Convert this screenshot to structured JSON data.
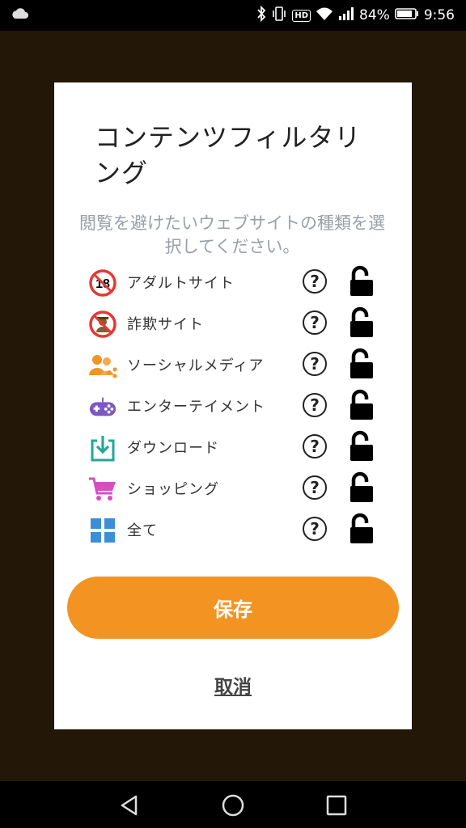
{
  "status_bar": {
    "battery_percent": "84%",
    "time": "9:56",
    "hd_badge": "HD",
    "icons": [
      "cloud-icon",
      "bluetooth-icon",
      "vibrate-icon",
      "hd-icon",
      "wifi-icon",
      "signal-icon",
      "battery-icon"
    ]
  },
  "dialog": {
    "title": "コンテンツフィルタリング",
    "subtitle": "閲覧を避けたいウェブサイトの種類を選択してください。",
    "help_label": "?",
    "categories": [
      {
        "label": "アダルトサイト",
        "icon": "adult-18-icon",
        "locked": false
      },
      {
        "label": "詐欺サイト",
        "icon": "fraud-icon",
        "locked": false
      },
      {
        "label": "ソーシャルメディア",
        "icon": "social-media-icon",
        "locked": false
      },
      {
        "label": "エンターテイメント",
        "icon": "gamepad-icon",
        "locked": false
      },
      {
        "label": "ダウンロード",
        "icon": "download-icon",
        "locked": false
      },
      {
        "label": "ショッピング",
        "icon": "shopping-cart-icon",
        "locked": false
      },
      {
        "label": "全て",
        "icon": "grid-icon",
        "locked": false
      }
    ],
    "save_label": "保存",
    "cancel_label": "取消",
    "adult_badge_text": "18"
  },
  "colors": {
    "accent": "#f39422",
    "backdrop": "#231707",
    "subtitle": "#9aa0a6"
  }
}
